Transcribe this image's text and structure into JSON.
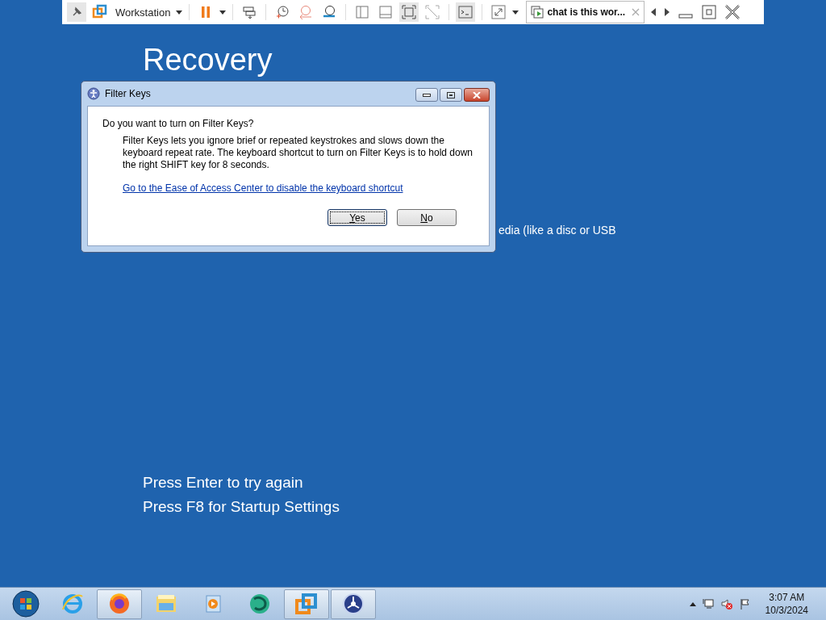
{
  "vm_toolbar": {
    "menu_label": "Workstation",
    "tab": {
      "title": "chat is this wor...",
      "selected": true
    }
  },
  "recovery": {
    "title": "Recovery",
    "hidden_line": "edia (like a disc or USB",
    "instructions": [
      "Press Enter to try again",
      "Press F8 for Startup Settings"
    ]
  },
  "dialog": {
    "title": "Filter Keys",
    "question": "Do you want to turn on Filter Keys?",
    "description": "Filter Keys lets you ignore brief or repeated keystrokes and slows down the keyboard repeat rate.  The keyboard shortcut to turn on Filter Keys is to hold down the right SHIFT key for 8 seconds.",
    "link": "Go to the Ease of Access Center to disable the keyboard shortcut",
    "buttons": [
      {
        "label": "Yes",
        "default": true
      },
      {
        "label": "No",
        "default": false
      }
    ]
  },
  "taskbar": {
    "apps": [
      {
        "kind": "ie",
        "running": false
      },
      {
        "kind": "firefox",
        "running": true
      },
      {
        "kind": "explorer",
        "running": false
      },
      {
        "kind": "media",
        "running": false
      },
      {
        "kind": "browser",
        "running": false
      },
      {
        "kind": "vmware",
        "running": true
      },
      {
        "kind": "network",
        "running": true
      }
    ],
    "clock": {
      "time": "3:07 AM",
      "date": "10/3/2024"
    }
  }
}
